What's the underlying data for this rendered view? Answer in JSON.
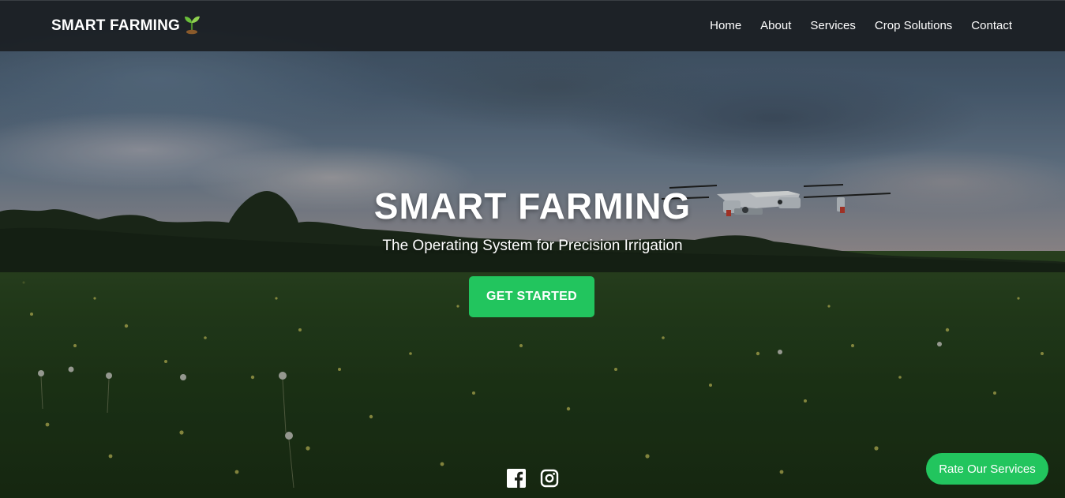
{
  "navbar": {
    "brand": "SMART FARMING",
    "brand_icon": "seedling-icon",
    "links": [
      {
        "label": "Home"
      },
      {
        "label": "About"
      },
      {
        "label": "Services"
      },
      {
        "label": "Crop Solutions"
      },
      {
        "label": "Contact"
      }
    ]
  },
  "hero": {
    "title": "SMART FARMING",
    "subtitle": "The Operating System for Precision Irrigation",
    "cta_label": "GET STARTED",
    "background": "field-with-drone-photo"
  },
  "social": [
    {
      "icon": "facebook-icon"
    },
    {
      "icon": "instagram-icon"
    }
  ],
  "rate_button": {
    "label": "Rate Our Services"
  },
  "colors": {
    "accent": "#22c55e",
    "navbar_bg": "#1c2024",
    "text": "#ffffff"
  }
}
